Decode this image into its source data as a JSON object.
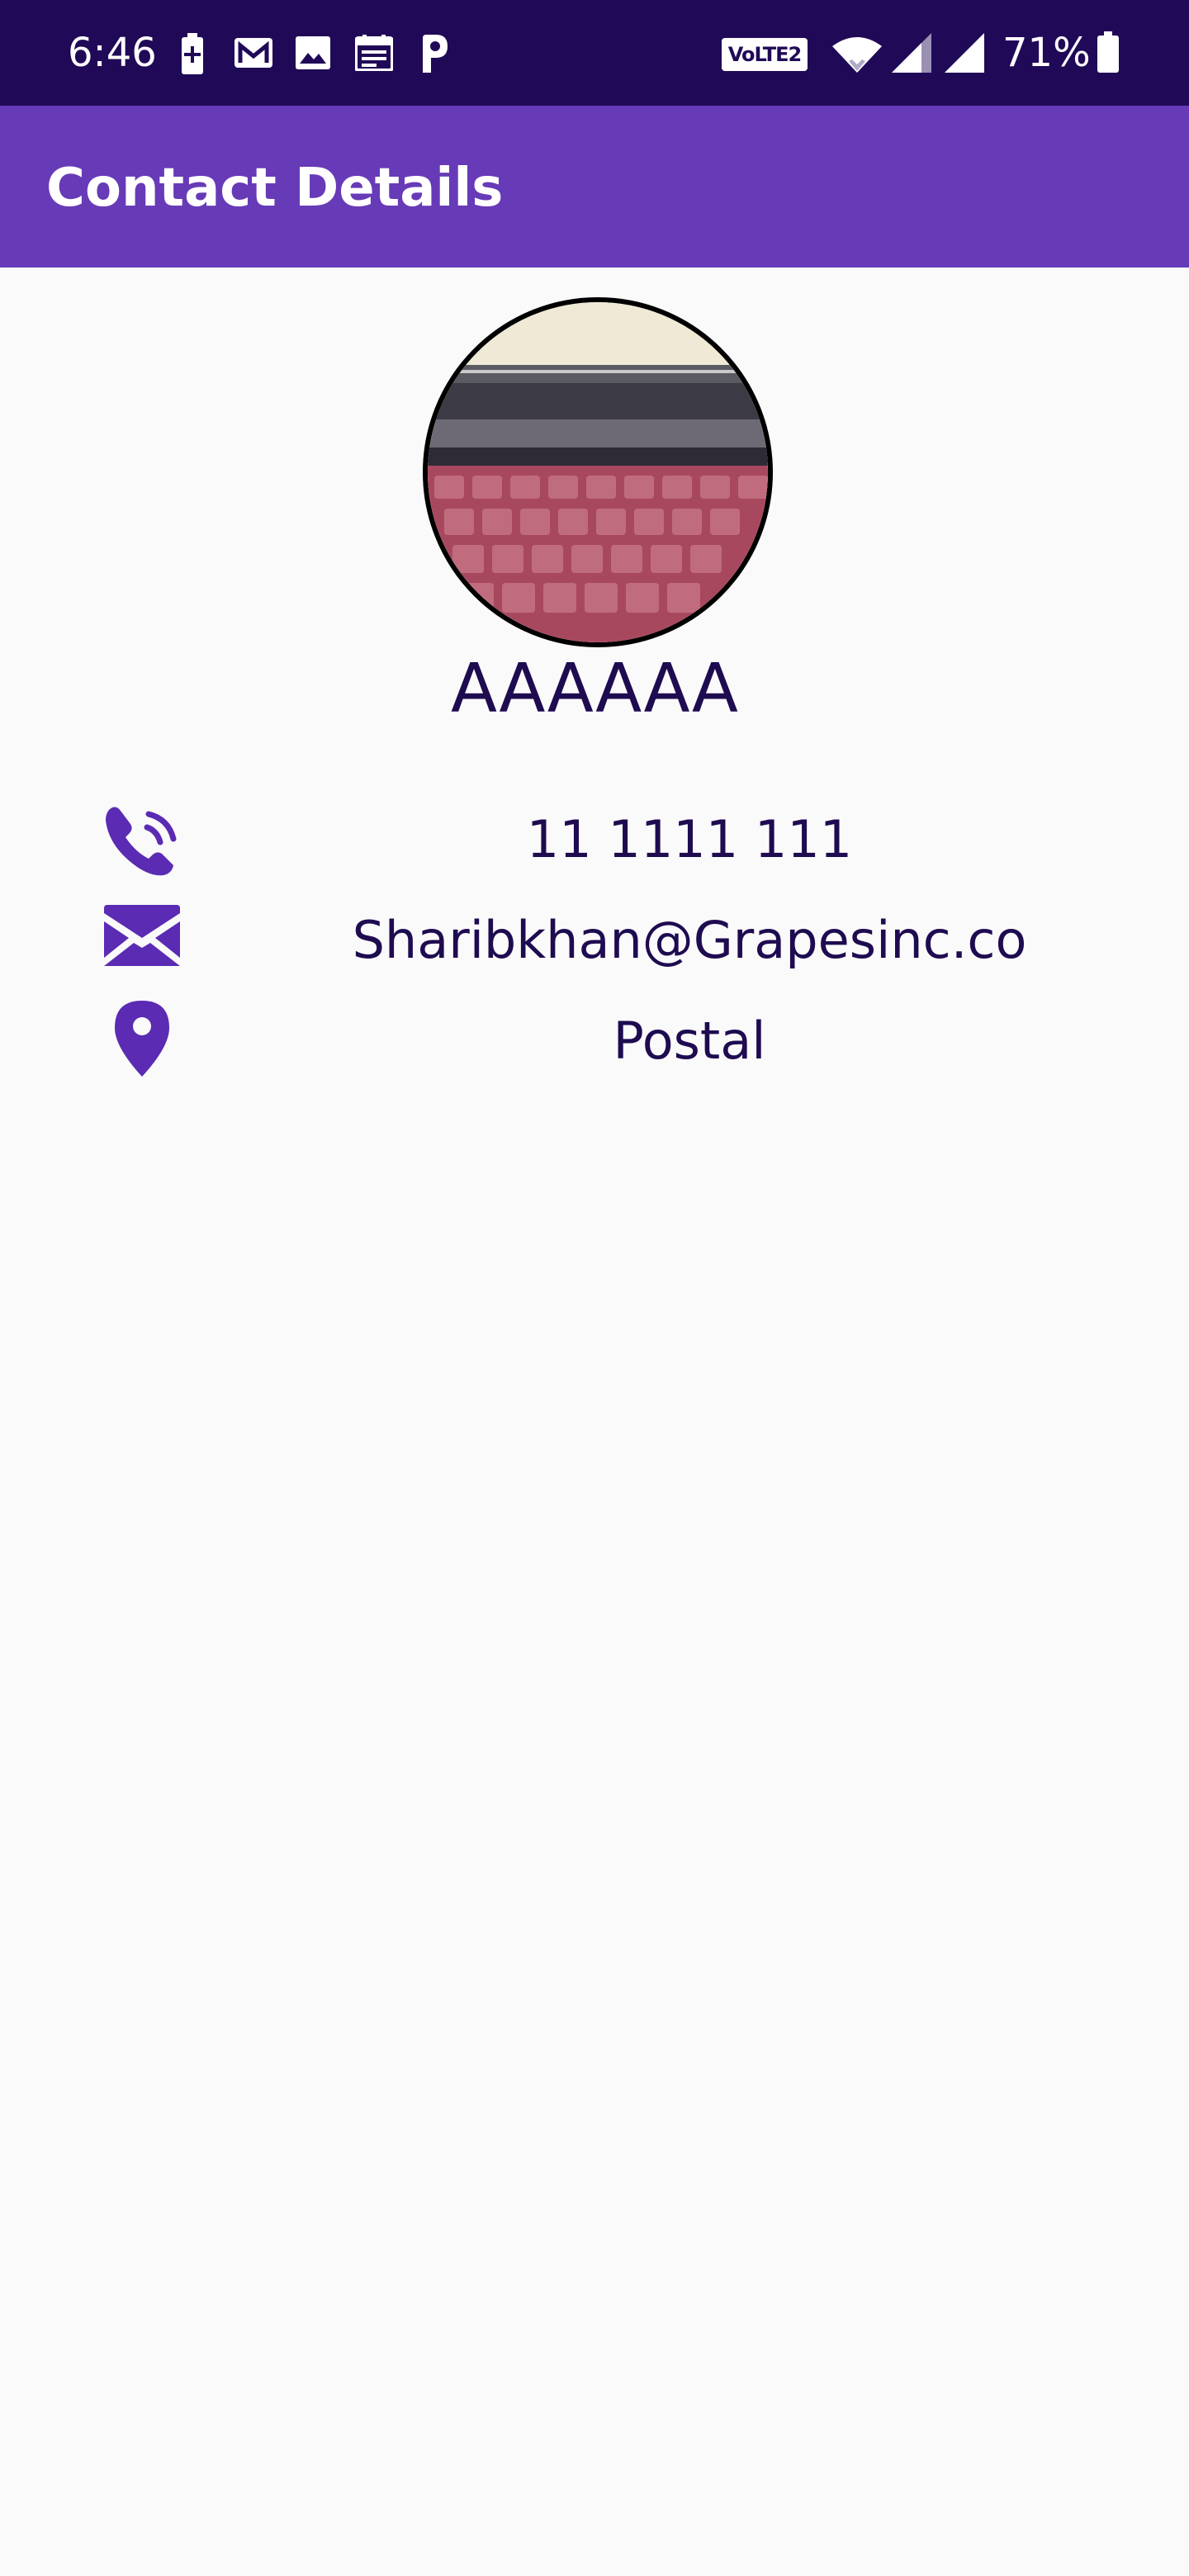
{
  "status_bar": {
    "time": "6:46",
    "network_badge": "VoLTE2",
    "battery_percent": "71%",
    "icons": [
      "battery-charging-icon",
      "gmail-icon",
      "gallery-icon",
      "calendar-icon",
      "parking-app-icon",
      "wifi-icon",
      "signal-icon",
      "signal-icon",
      "battery-icon"
    ]
  },
  "app_bar": {
    "title": "Contact Details"
  },
  "contact": {
    "name": "AAAAAA",
    "phone": "11 1111 111",
    "email": "Sharibkhan@Grapesinc.co",
    "address": "Postal"
  },
  "colors": {
    "status_bar": "#200a57",
    "app_bar": "#673ab7",
    "icon_accent": "#5b2bb3",
    "text": "#1e0b50",
    "background": "#fafafa"
  }
}
